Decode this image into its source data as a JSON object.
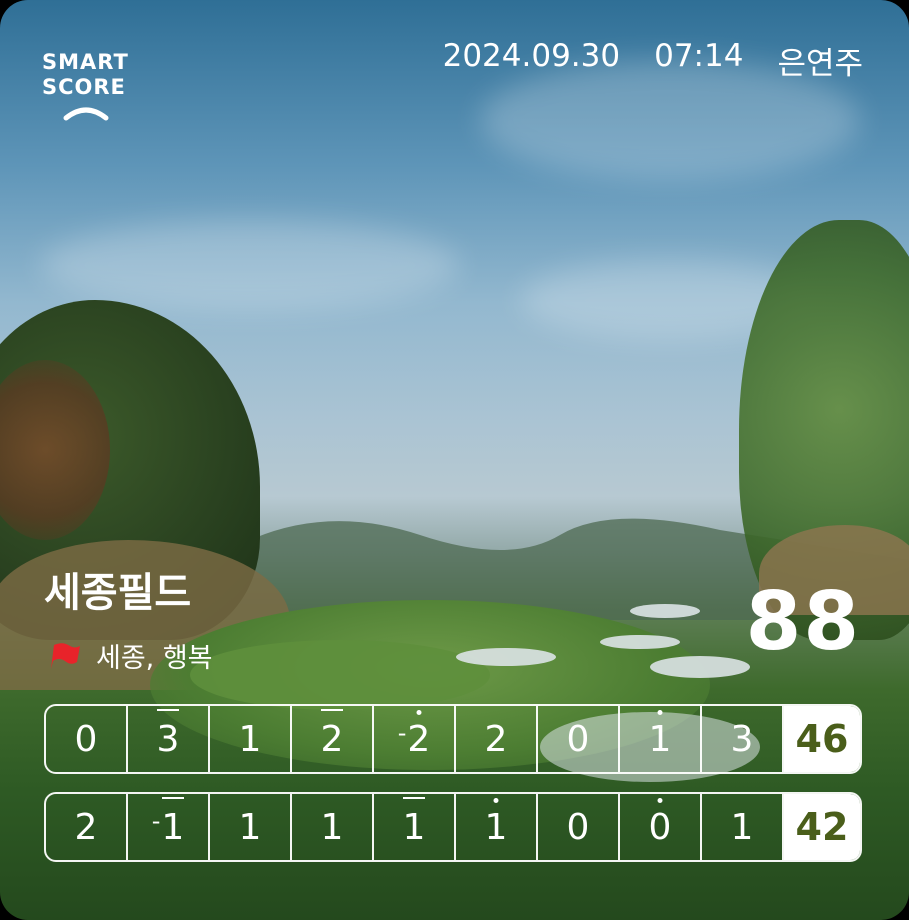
{
  "header": {
    "logo_line1": "SMART",
    "logo_line2": "SCORE",
    "date": "2024.09.30",
    "time": "07:14",
    "player": "은연주"
  },
  "course": {
    "name": "세종필드",
    "location": "세종, 행복",
    "total_score": "88"
  },
  "scorecard": {
    "front": {
      "holes": [
        {
          "prefix": "",
          "value": "0",
          "mark": "none"
        },
        {
          "prefix": "",
          "value": "3",
          "mark": "bar"
        },
        {
          "prefix": "",
          "value": "1",
          "mark": "none"
        },
        {
          "prefix": "",
          "value": "2",
          "mark": "bar"
        },
        {
          "prefix": "-",
          "value": "2",
          "mark": "dot"
        },
        {
          "prefix": "",
          "value": "2",
          "mark": "none"
        },
        {
          "prefix": "",
          "value": "0",
          "mark": "none"
        },
        {
          "prefix": "",
          "value": "1",
          "mark": "dot"
        },
        {
          "prefix": "",
          "value": "3",
          "mark": "none"
        }
      ],
      "subtotal": "46"
    },
    "back": {
      "holes": [
        {
          "prefix": "",
          "value": "2",
          "mark": "none"
        },
        {
          "prefix": "-",
          "value": "1",
          "mark": "bar"
        },
        {
          "prefix": "",
          "value": "1",
          "mark": "none"
        },
        {
          "prefix": "",
          "value": "1",
          "mark": "none"
        },
        {
          "prefix": "",
          "value": "1",
          "mark": "bar"
        },
        {
          "prefix": "",
          "value": "1",
          "mark": "dot"
        },
        {
          "prefix": "",
          "value": "0",
          "mark": "none"
        },
        {
          "prefix": "",
          "value": "0",
          "mark": "dot"
        },
        {
          "prefix": "",
          "value": "1",
          "mark": "none"
        }
      ],
      "subtotal": "42"
    }
  },
  "colors": {
    "subtotal_text": "#4a5e1a",
    "flag": "#e8232a"
  }
}
